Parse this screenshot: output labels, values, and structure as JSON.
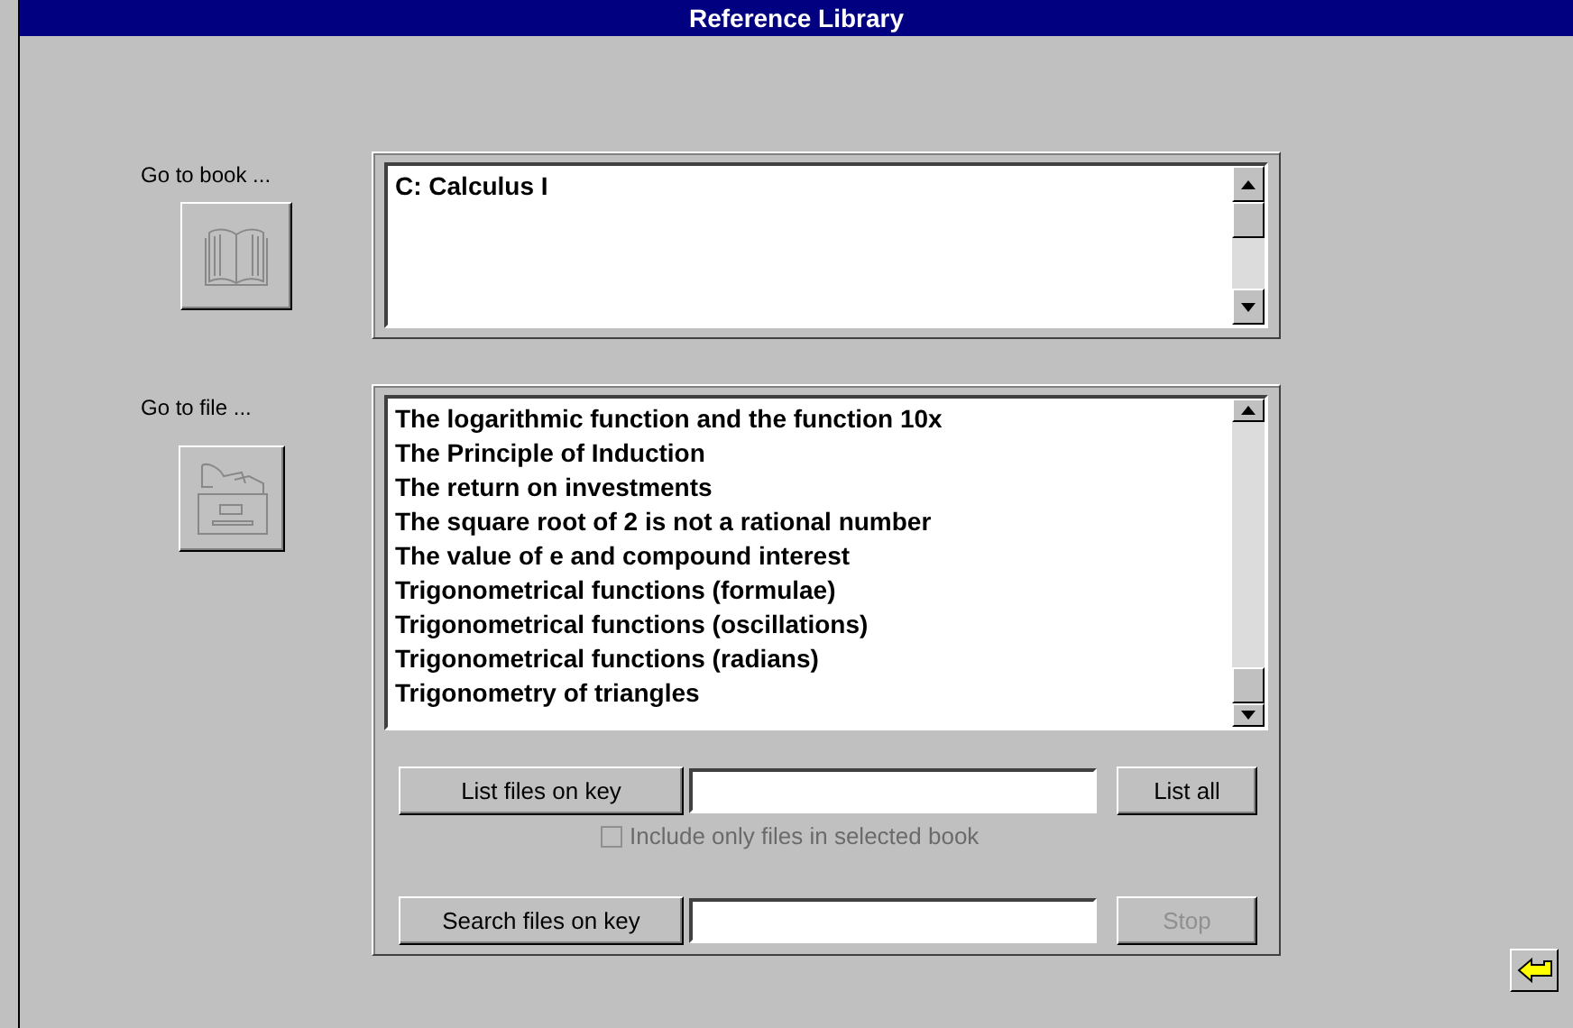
{
  "window": {
    "title": "Reference Library"
  },
  "book": {
    "label": "Go to book ...",
    "button_disabled": true,
    "items": [
      "C: Calculus I"
    ]
  },
  "file": {
    "label": "Go to file ...",
    "button_disabled": true,
    "items": [
      "The logarithmic function and the function 10x",
      "The Principle of Induction",
      "The return on investments",
      "The square root of 2 is not a rational number",
      "The value of e and compound interest",
      "Trigonometrical functions (formulae)",
      "Trigonometrical functions (oscillations)",
      "Trigonometrical functions (radians)",
      "Trigonometry of triangles"
    ]
  },
  "list_row": {
    "button": "List files on key",
    "side_button": {
      "label": "List all",
      "disabled": false
    }
  },
  "checkbox": {
    "label": "Include only files in selected book",
    "checked": false,
    "disabled": true
  },
  "search_row": {
    "button": "Search files on key",
    "side_button": {
      "label": "Stop",
      "disabled": true
    }
  }
}
